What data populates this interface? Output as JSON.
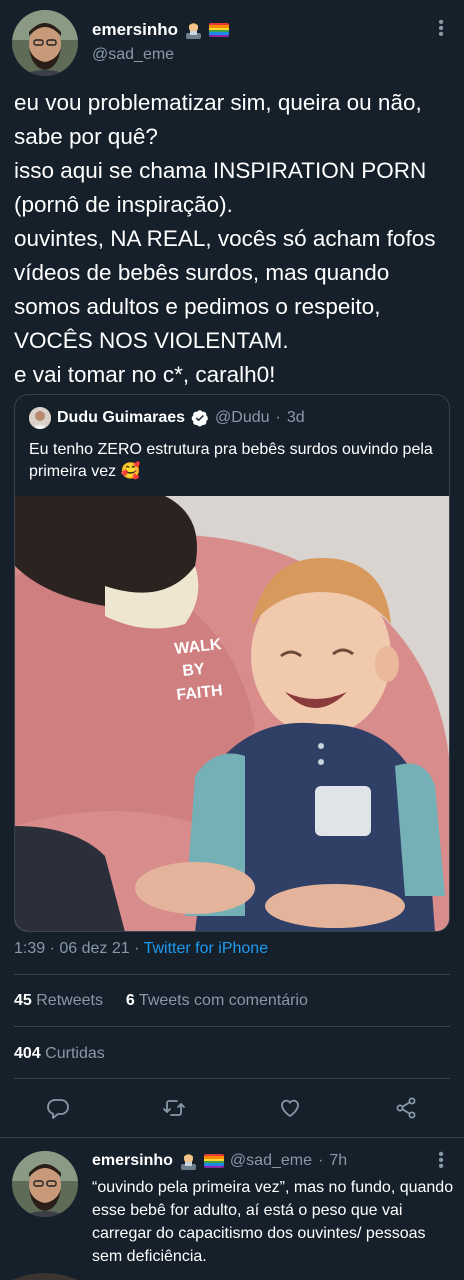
{
  "tweet": {
    "author": {
      "display_name": "emersinho",
      "handle": "@sad_eme",
      "badges": [
        "man-technologist-emoji",
        "rainbow-flag-emoji"
      ]
    },
    "text": "eu vou problematizar sim, queira ou não, sabe por quê?\nisso aqui se chama INSPIRATION PORN (pornô de inspiração).\nouvintes, NA REAL, vocês só acham fofos vídeos de bebês surdos, mas quando somos adultos e pedimos o respeito, VOCÊS NOS VIOLENTAM.\ne vai tomar no c*, caralh0!",
    "quoted": {
      "display_name": "Dudu Guimaraes",
      "handle": "@Dudu",
      "separator": "·",
      "time": "3d",
      "text": "Eu tenho ZERO estrutura pra bebês surdos ouvindo pela primeira vez 🥰",
      "image_shirt_text": [
        "WALK",
        "BY",
        "FAITH"
      ]
    },
    "time": "1:39",
    "date": "06 dez 21",
    "source": "Twitter for iPhone",
    "retweets_count": "45",
    "retweets_label": "Retweets",
    "quote_tweets_count": "6",
    "quote_tweets_label": "Tweets com comentário",
    "likes_count": "404",
    "likes_label": "Curtidas"
  },
  "actions": [
    {
      "name": "reply-icon"
    },
    {
      "name": "retweet-icon"
    },
    {
      "name": "like-icon"
    },
    {
      "name": "share-icon"
    }
  ],
  "reply": {
    "display_name": "emersinho",
    "handle": "@sad_eme",
    "separator": "·",
    "time": "7h",
    "text": "“ouvindo pela primeira vez”, mas no fundo, quando esse bebê for adulto, aí está o peso que vai carregar do capacitismo dos ouvintes/ pessoas sem deficiência."
  },
  "colors": {
    "background": "#15202b",
    "secondary_text": "#8899a6",
    "accent": "#1d9bf0",
    "border": "#38444d"
  }
}
